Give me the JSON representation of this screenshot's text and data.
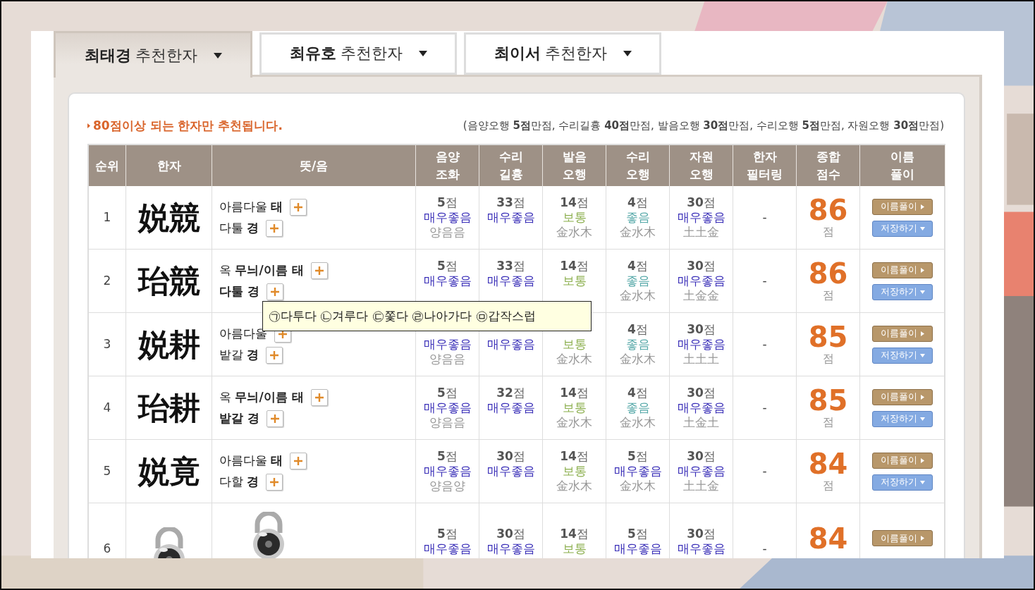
{
  "tabs": [
    {
      "label": "**최태경** 추천한자",
      "selected": true
    },
    {
      "label": "**최유호** 추천한자",
      "selected": false
    },
    {
      "label": "**최이서** 추천한자",
      "selected": false
    }
  ],
  "notice": "80점이상 되는 한자만 추천됩니다.",
  "scoring_note": "(음양오행 **5점**만점, 수리길흉 **40점**만점, 발음오행 **30점**만점, 수리오행 **5점**만점, 자원오행 **30점**만점)",
  "table": {
    "columns": [
      "순위",
      "한자",
      "뜻/음",
      "음양\n조화",
      "수리\n길흉",
      "발음\n오행",
      "수리\n오행",
      "자원\n오행",
      "한자\n필터링",
      "종합\n점수",
      "이름\n풀이"
    ],
    "rows": [
      {
        "cells": [
          {
            "kind": "rank",
            "text": "1"
          },
          {
            "kind": "hanja",
            "text": "娧競"
          },
          {
            "kind": "meaning",
            "lines": [
              "아름다울 **태**",
              "다툴 **경**"
            ]
          },
          {
            "kind": "rating",
            "points": "**5**점",
            "grade": "매우좋음",
            "color": "#3a2fb8",
            "detail": "양음음"
          },
          {
            "kind": "rating",
            "points": "**33**점",
            "grade": "매우좋음",
            "color": "#3a2fb8"
          },
          {
            "kind": "rating",
            "points": "**14**점",
            "grade": "보통",
            "color": "#8db050",
            "detail": "金水木"
          },
          {
            "kind": "rating",
            "points": "**4**점",
            "grade": "좋음",
            "color": "#55a8a8",
            "detail": "金水木"
          },
          {
            "kind": "rating",
            "points": "**30**점",
            "grade": "매우좋음",
            "color": "#3a2fb8",
            "detail": "土土金"
          },
          {
            "kind": "filter",
            "text": "-"
          },
          {
            "kind": "score",
            "text": "86",
            "unit": "점"
          },
          {
            "kind": "actions",
            "buttons": [
              "이름풀이",
              "저장하기"
            ]
          }
        ]
      },
      {
        "cells": [
          {
            "kind": "rank",
            "text": "2"
          },
          {
            "kind": "hanja",
            "text": "珆競"
          },
          {
            "kind": "meaning",
            "lines": [
              "옥 **무늬/이름 태**",
              "**다툴 경**"
            ]
          },
          {
            "kind": "rating",
            "points": "**5**점",
            "grade": "매우좋음",
            "color": "#3a2fb8"
          },
          {
            "kind": "rating",
            "points": "**33**점",
            "grade": "매우좋음",
            "color": "#3a2fb8"
          },
          {
            "kind": "rating",
            "points": "**14**점",
            "grade": "보통",
            "color": "#8db050"
          },
          {
            "kind": "rating",
            "points": "**4**점",
            "grade": "좋음",
            "color": "#55a8a8",
            "detail": "金水木"
          },
          {
            "kind": "rating",
            "points": "**30**점",
            "grade": "매우좋음",
            "color": "#3a2fb8",
            "detail": "土金金"
          },
          {
            "kind": "filter",
            "text": "-"
          },
          {
            "kind": "score",
            "text": "86",
            "unit": "점"
          },
          {
            "kind": "actions",
            "buttons": [
              "이름풀이",
              "저장하기"
            ]
          }
        ]
      },
      {
        "cells": [
          {
            "kind": "rank",
            "text": "3"
          },
          {
            "kind": "hanja",
            "text": "娧耕"
          },
          {
            "kind": "meaning",
            "lines": [
              "아름다울",
              "밭갈 **경**"
            ]
          },
          {
            "kind": "rating",
            "grade": "매우좋음",
            "color": "#3a2fb8",
            "detail": "양음음"
          },
          {
            "kind": "rating",
            "grade": "매우좋음",
            "color": "#3a2fb8"
          },
          {
            "kind": "rating",
            "grade": "보통",
            "color": "#8db050",
            "detail": "金水木"
          },
          {
            "kind": "rating",
            "points": "**4**점",
            "grade": "좋음",
            "color": "#55a8a8",
            "detail": "金水木"
          },
          {
            "kind": "rating",
            "points": "**30**점",
            "grade": "매우좋음",
            "color": "#3a2fb8",
            "detail": "土土土"
          },
          {
            "kind": "filter",
            "text": "-"
          },
          {
            "kind": "score",
            "text": "85",
            "unit": "점"
          },
          {
            "kind": "actions",
            "buttons": [
              "이름풀이",
              "저장하기"
            ]
          }
        ]
      },
      {
        "cells": [
          {
            "kind": "rank",
            "text": "4"
          },
          {
            "kind": "hanja",
            "text": "珆耕"
          },
          {
            "kind": "meaning",
            "lines": [
              "옥 **무늬/이름 태**",
              "**밭갈 경**"
            ]
          },
          {
            "kind": "rating",
            "points": "**5**점",
            "grade": "매우좋음",
            "color": "#3a2fb8",
            "detail": "양음음"
          },
          {
            "kind": "rating",
            "points": "**32**점",
            "grade": "매우좋음",
            "color": "#3a2fb8"
          },
          {
            "kind": "rating",
            "points": "**14**점",
            "grade": "보통",
            "color": "#8db050",
            "detail": "金水木"
          },
          {
            "kind": "rating",
            "points": "**4**점",
            "grade": "좋음",
            "color": "#55a8a8",
            "detail": "金水木"
          },
          {
            "kind": "rating",
            "points": "**30**점",
            "grade": "매우좋음",
            "color": "#3a2fb8",
            "detail": "土金土"
          },
          {
            "kind": "filter",
            "text": "-"
          },
          {
            "kind": "score",
            "text": "85",
            "unit": "점"
          },
          {
            "kind": "actions",
            "buttons": [
              "이름풀이",
              "저장하기"
            ]
          }
        ]
      },
      {
        "cells": [
          {
            "kind": "rank",
            "text": "5"
          },
          {
            "kind": "hanja",
            "text": "娧竟"
          },
          {
            "kind": "meaning",
            "lines": [
              "아름다울 **태**",
              "다할 **경**"
            ]
          },
          {
            "kind": "rating",
            "points": "**5**점",
            "grade": "매우좋음",
            "color": "#3a2fb8",
            "detail": "양음양"
          },
          {
            "kind": "rating",
            "points": "**30**점",
            "grade": "매우좋음",
            "color": "#3a2fb8"
          },
          {
            "kind": "rating",
            "points": "**14**점",
            "grade": "보통",
            "color": "#8db050",
            "detail": "金水木"
          },
          {
            "kind": "rating",
            "points": "**5**점",
            "grade": "매우좋음",
            "color": "#3a2fb8",
            "detail": "金水木"
          },
          {
            "kind": "rating",
            "points": "**30**점",
            "grade": "매우좋음",
            "color": "#3a2fb8",
            "detail": "土土金"
          },
          {
            "kind": "filter",
            "text": "-"
          },
          {
            "kind": "score",
            "text": "84",
            "unit": "점"
          },
          {
            "kind": "actions",
            "buttons": [
              "이름풀이",
              "저장하기"
            ]
          }
        ]
      },
      {
        "cells": [
          {
            "kind": "rank",
            "text": "6"
          },
          {
            "kind": "picture"
          },
          {
            "kind": "picture"
          },
          {
            "kind": "rating",
            "points": "**5**점",
            "grade": "매우좋음",
            "color": "#3a2fb8"
          },
          {
            "kind": "rating",
            "points": "**30**점",
            "grade": "매우좋음",
            "color": "#3a2fb8"
          },
          {
            "kind": "rating",
            "points": "**14**점",
            "grade": "보통",
            "color": "#8db050"
          },
          {
            "kind": "rating",
            "points": "**5**점",
            "grade": "매우좋음",
            "color": "#3a2fb8"
          },
          {
            "kind": "rating",
            "points": "**30**점",
            "grade": "매우좋음",
            "color": "#3a2fb8"
          },
          {
            "kind": "filter",
            "text": "-"
          },
          {
            "kind": "score",
            "text": "84"
          },
          {
            "kind": "actions",
            "buttons": [
              "이름풀이"
            ]
          }
        ]
      }
    ]
  },
  "tooltip": "㉠다투다 ㉡겨루다 ㉢쫓다 ㉣나아가다 ㉤갑작스럽"
}
